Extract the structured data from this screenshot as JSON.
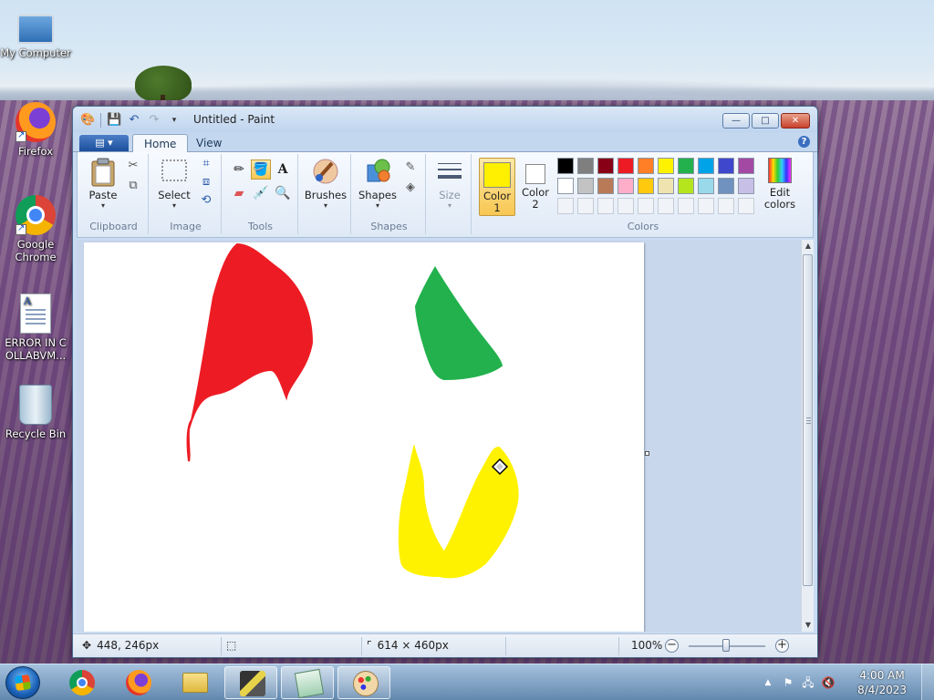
{
  "desktop": {
    "icons": [
      {
        "label": "My Computer",
        "icon": "computer-icon"
      },
      {
        "label": "Firefox",
        "icon": "firefox-icon"
      },
      {
        "label": "Google Chrome",
        "icon": "chrome-icon"
      },
      {
        "label": "ERROR IN COLLABVM...",
        "icon": "document-icon"
      },
      {
        "label": "Recycle Bin",
        "icon": "recycle-bin-icon"
      }
    ]
  },
  "window": {
    "title": "Untitled - Paint",
    "buttons": {
      "minimize": "—",
      "maximize": "□",
      "close": "✕"
    }
  },
  "ribbon": {
    "app_menu": "▤ ▾",
    "tabs": [
      {
        "label": "Home",
        "active": true
      },
      {
        "label": "View",
        "active": false
      }
    ],
    "help": "?",
    "groups": {
      "clipboard": {
        "label": "Clipboard",
        "paste": "Paste"
      },
      "image": {
        "label": "Image",
        "select": "Select"
      },
      "tools": {
        "label": "Tools",
        "selected": "fill"
      },
      "brushes": {
        "label": "Brushes"
      },
      "shapes": {
        "label": "Shapes",
        "button": "Shapes"
      },
      "size": {
        "label": "Size"
      },
      "colors": {
        "label": "Colors",
        "color1_label": "Color 1",
        "color2_label": "Color 2",
        "color1": "#ffef00",
        "color2": "#ffffff",
        "edit_label": "Edit colors",
        "palette_row1": [
          "#000000",
          "#7f7f7f",
          "#880015",
          "#ed1c24",
          "#ff7f27",
          "#fff200",
          "#22b14c",
          "#00a2e8",
          "#3f48cc",
          "#a349a4"
        ],
        "palette_row2": [
          "#ffffff",
          "#c3c3c3",
          "#b97a57",
          "#ffaec9",
          "#ffc90e",
          "#efe4b0",
          "#b5e61d",
          "#99d9ea",
          "#7092be",
          "#c8bfe7"
        ],
        "palette_row3_count": 10
      }
    }
  },
  "canvas": {
    "shapes": [
      {
        "name": "red-shape",
        "color": "#ed1c24"
      },
      {
        "name": "green-shape",
        "color": "#22b14c"
      },
      {
        "name": "yellow-shape",
        "color": "#fff200"
      }
    ]
  },
  "statusbar": {
    "cursor_pos": "448, 246px",
    "selection_size": "",
    "image_size": "614 × 460px",
    "zoom": "100%"
  },
  "taskbar": {
    "pinned": [
      "internet-explorer-icon",
      "chrome-icon",
      "firefox-icon",
      "explorer-folder-icon",
      "app-icon",
      "notepad-icon",
      "paint-icon"
    ],
    "clock": {
      "time": "4:00 AM",
      "date": "8/4/2023"
    }
  }
}
